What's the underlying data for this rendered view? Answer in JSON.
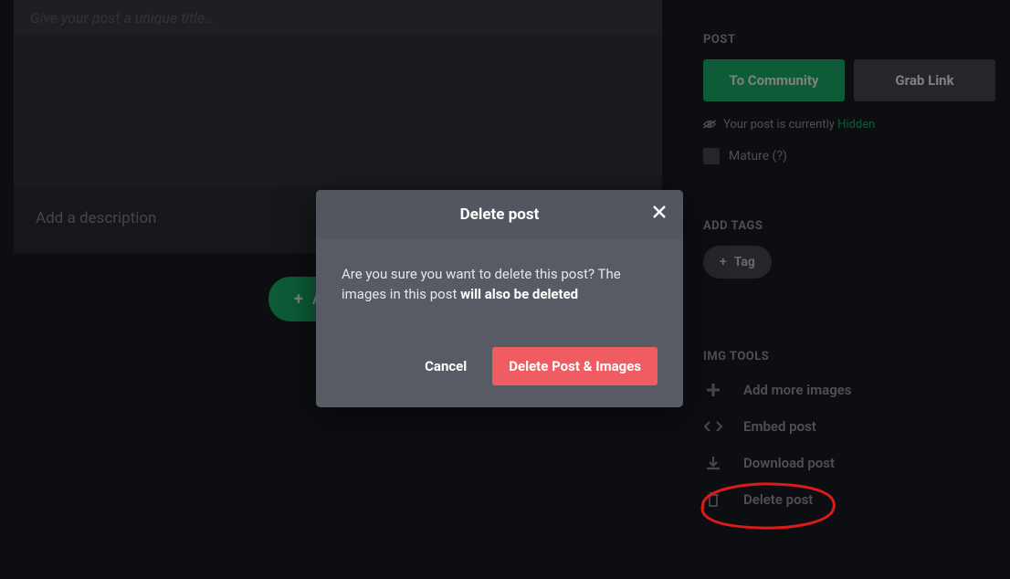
{
  "editor": {
    "title_placeholder": "Give your post a unique title...",
    "description_placeholder": "Add a description",
    "add_image_label": "Add image"
  },
  "sidebar": {
    "post_label": "POST",
    "to_community_btn": "To Community",
    "grab_link_btn": "Grab Link",
    "status_prefix": "Your post is currently ",
    "status_value": "Hidden",
    "mature_label": "Mature (?)",
    "add_tags_label": "ADD TAGS",
    "tag_btn_label": "Tag",
    "tools_label": "IMG TOOLS",
    "tools": [
      {
        "label": "Add more images",
        "icon": "plus"
      },
      {
        "label": "Embed post",
        "icon": "embed"
      },
      {
        "label": "Download post",
        "icon": "download"
      },
      {
        "label": "Delete post",
        "icon": "trash"
      }
    ]
  },
  "modal": {
    "title": "Delete post",
    "body_text": "Are you sure you want to delete this post? The images in this post ",
    "body_bold": "will also be deleted",
    "cancel_label": "Cancel",
    "confirm_label": "Delete Post & Images"
  }
}
